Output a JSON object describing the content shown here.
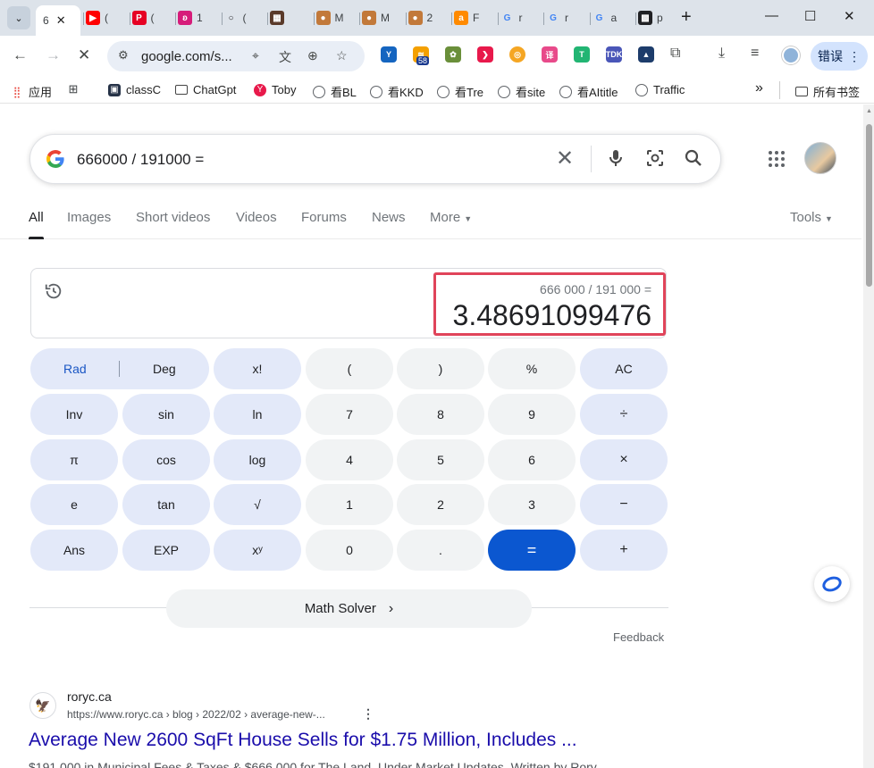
{
  "browser": {
    "active_tab_title": "6",
    "tabs": [
      {
        "fav": "youtube",
        "color": "#ff0000",
        "label": "("
      },
      {
        "fav": "pinterest",
        "color": "#e60023",
        "label": "("
      },
      {
        "fav": "butterfly",
        "color": "#d61c7a",
        "label": "1"
      },
      {
        "fav": "circle",
        "color": "#202124",
        "label": "("
      },
      {
        "fav": "image",
        "color": "#5a3a2a",
        "label": ""
      },
      {
        "fav": "cookie",
        "color": "#c2793a",
        "label": "M"
      },
      {
        "fav": "cookie",
        "color": "#c2793a",
        "label": "M"
      },
      {
        "fav": "cookie",
        "color": "#c2793a",
        "label": "2"
      },
      {
        "fav": "a",
        "color": "#ff8a00",
        "label": "F"
      },
      {
        "fav": "google",
        "color": "#4285f4",
        "label": "r"
      },
      {
        "fav": "google",
        "color": "#4285f4",
        "label": "r"
      },
      {
        "fav": "google",
        "color": "#4285f4",
        "label": "a"
      },
      {
        "fav": "dark",
        "color": "#202124",
        "label": "p"
      }
    ],
    "url": "google.com/s...",
    "error_button_label": "错误",
    "extension_badge": "58"
  },
  "bookmarks": [
    {
      "label": "应用",
      "icon": "apps-icon"
    },
    {
      "label": "",
      "icon": "grid-icon"
    },
    {
      "label": "classC",
      "icon": "classc-icon"
    },
    {
      "label": "ChatGpt",
      "icon": "folder-icon"
    },
    {
      "label": "Toby",
      "icon": "toby-icon"
    },
    {
      "label": "看BL",
      "icon": "globe-icon"
    },
    {
      "label": "看KKD",
      "icon": "globe-icon"
    },
    {
      "label": "看Tre",
      "icon": "globe-icon"
    },
    {
      "label": "看site",
      "icon": "globe-icon"
    },
    {
      "label": "看AItitle",
      "icon": "globe-icon"
    },
    {
      "label": "Traffic",
      "icon": "globe-icon"
    }
  ],
  "bookmarks_more": "»",
  "bookmarks_all": "所有书签",
  "search": {
    "query": "666000 / 191000 =",
    "tabs": [
      "All",
      "Images",
      "Short videos",
      "Videos",
      "Forums",
      "News",
      "More"
    ],
    "tools": "Tools"
  },
  "calculator": {
    "expression": "666 000 / 191 000 =",
    "result": "3.48691099476",
    "rad": "Rad",
    "deg": "Deg",
    "rows": [
      [
        "x!",
        "(",
        ")",
        "%",
        "AC"
      ],
      [
        "Inv",
        "sin",
        "ln",
        "7",
        "8",
        "9",
        "÷"
      ],
      [
        "π",
        "cos",
        "log",
        "4",
        "5",
        "6",
        "×"
      ],
      [
        "e",
        "tan",
        "√",
        "1",
        "2",
        "3",
        "−"
      ],
      [
        "Ans",
        "EXP",
        "xʸ",
        "0",
        ".",
        "=",
        "+"
      ]
    ],
    "math_solver": "Math Solver",
    "feedback": "Feedback"
  },
  "result_item": {
    "site_name": "roryc.ca",
    "url": "https://www.roryc.ca › blog › 2022/02 › average-new-...",
    "title": "Average New 2600 SqFt House Sells for $1.75 Million, Includes ...",
    "snippet": "$191,000 in Municipal Fees & Taxes & $666,000 for The Land. Under Market Updates. Written by Rory"
  },
  "colors": {
    "accent": "#0b57d0",
    "link": "#1a0dab",
    "highlight_box": "#e0445a",
    "fn_key": "#e3e9f9",
    "num_key": "#f1f3f4"
  }
}
